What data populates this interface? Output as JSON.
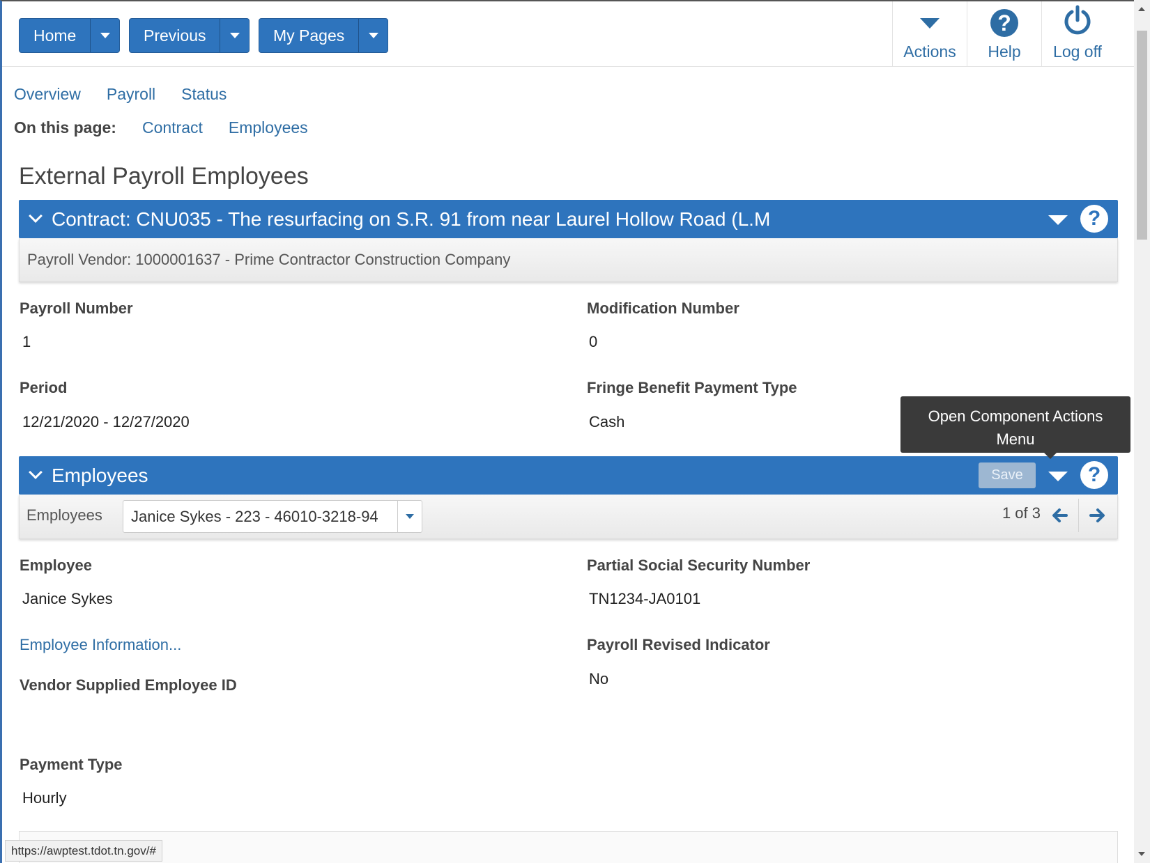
{
  "topbar": {
    "home_label": "Home",
    "previous_label": "Previous",
    "mypages_label": "My Pages",
    "actions_label": "Actions",
    "help_label": "Help",
    "logoff_label": "Log off"
  },
  "page_nav": {
    "items": [
      "Overview",
      "Payroll",
      "Status"
    ],
    "on_this_page_label": "On this page:",
    "anchors": [
      "Contract",
      "Employees"
    ]
  },
  "page_title": "External Payroll Employees",
  "contract": {
    "header": "Contract: CNU035 - The resurfacing on S.R. 91 from near Laurel Hollow Road (L.M",
    "vendor": "Payroll Vendor: 1000001637 - Prime Contractor Construction Company",
    "fields": {
      "payroll_number_label": "Payroll Number",
      "payroll_number": "1",
      "modification_number_label": "Modification Number",
      "modification_number": "0",
      "period_label": "Period",
      "period": "12/21/2020 - 12/27/2020",
      "fringe_label": "Fringe Benefit Payment Type",
      "fringe": "Cash"
    }
  },
  "tooltip": {
    "line1": "Open Component Actions",
    "line2": "Menu"
  },
  "employees": {
    "header": "Employees",
    "save_label": "Save",
    "select_label": "Employees",
    "selected": "Janice Sykes - 223 - 46010-3218-94",
    "pager": "1 of 3",
    "fields": {
      "employee_label": "Employee",
      "employee": "Janice Sykes",
      "ssn_label": "Partial Social Security Number",
      "ssn": "TN1234-JA0101",
      "info_link": "Employee Information...",
      "revised_label": "Payroll Revised Indicator",
      "revised": "No",
      "vendor_id_label": "Vendor Supplied Employee ID",
      "payment_type_label": "Payment Type",
      "payment_type": "Hourly"
    }
  },
  "status_url": "https://awptest.tdot.tn.gov/#",
  "colors": {
    "brand_blue": "#2e74bd",
    "link_blue": "#2e6da4",
    "tooltip_bg": "#3a3a3a"
  }
}
